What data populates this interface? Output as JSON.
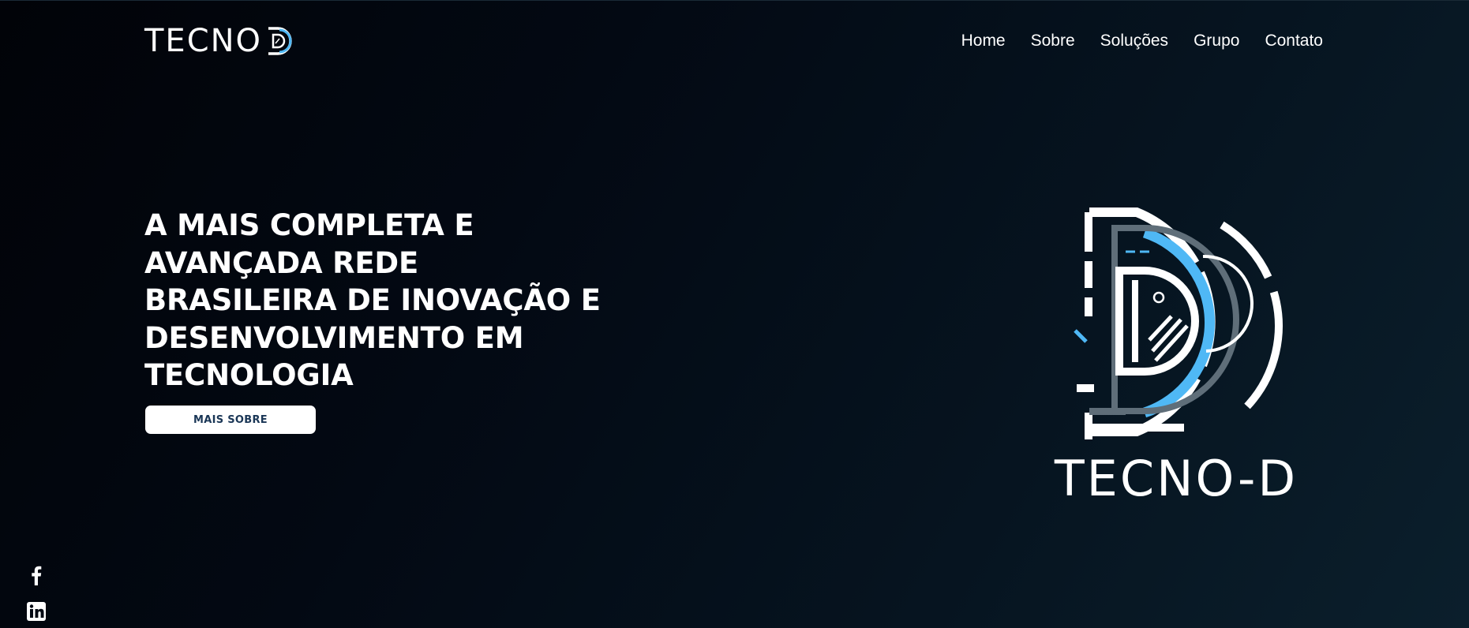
{
  "header": {
    "logo_text": "TECNO"
  },
  "nav": {
    "items": [
      {
        "label": "Home"
      },
      {
        "label": "Sobre"
      },
      {
        "label": "Soluções"
      },
      {
        "label": "Grupo"
      },
      {
        "label": "Contato"
      }
    ]
  },
  "hero": {
    "title_lines": [
      "A MAIS COMPLETA E",
      "AVANÇADA REDE",
      "BRASILEIRA DE INOVAÇÃO E",
      "DESENVOLVIMENTO EM",
      "TECNOLOGIA"
    ],
    "cta_label": "MAIS SOBRE"
  },
  "brand": {
    "name": "TECNO-D"
  },
  "social": {
    "icons": [
      "facebook-icon",
      "linkedin-icon"
    ]
  },
  "colors": {
    "background_dark": "#010308",
    "background_light": "#0b1f2c",
    "accent_blue": "#4fb8f5",
    "gray": "#5f6e79",
    "button_text": "#1a3656"
  }
}
